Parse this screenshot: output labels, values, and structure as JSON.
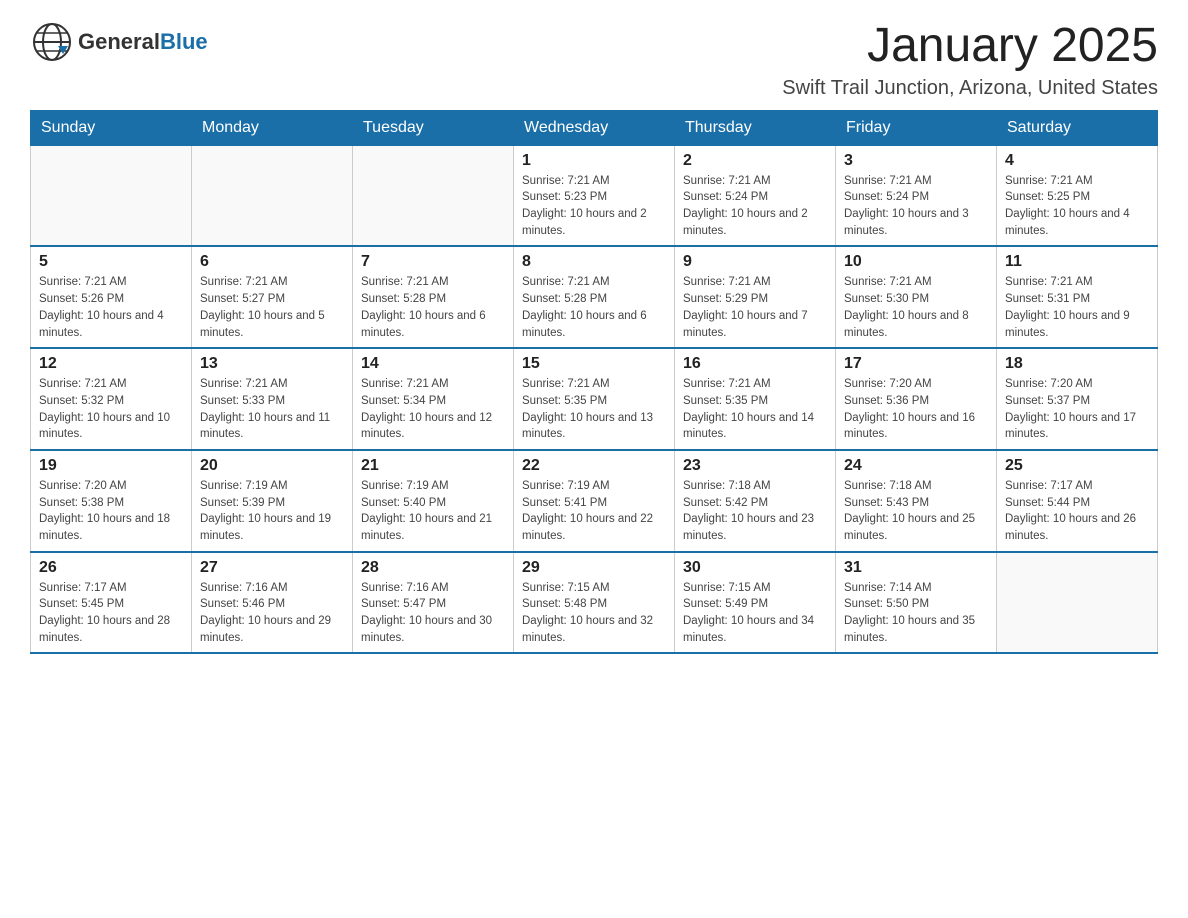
{
  "header": {
    "logo_general": "General",
    "logo_blue": "Blue",
    "month_year": "January 2025",
    "location": "Swift Trail Junction, Arizona, United States"
  },
  "weekdays": [
    "Sunday",
    "Monday",
    "Tuesday",
    "Wednesday",
    "Thursday",
    "Friday",
    "Saturday"
  ],
  "weeks": [
    [
      {
        "day": "",
        "sunrise": "",
        "sunset": "",
        "daylight": ""
      },
      {
        "day": "",
        "sunrise": "",
        "sunset": "",
        "daylight": ""
      },
      {
        "day": "",
        "sunrise": "",
        "sunset": "",
        "daylight": ""
      },
      {
        "day": "1",
        "sunrise": "Sunrise: 7:21 AM",
        "sunset": "Sunset: 5:23 PM",
        "daylight": "Daylight: 10 hours and 2 minutes."
      },
      {
        "day": "2",
        "sunrise": "Sunrise: 7:21 AM",
        "sunset": "Sunset: 5:24 PM",
        "daylight": "Daylight: 10 hours and 2 minutes."
      },
      {
        "day": "3",
        "sunrise": "Sunrise: 7:21 AM",
        "sunset": "Sunset: 5:24 PM",
        "daylight": "Daylight: 10 hours and 3 minutes."
      },
      {
        "day": "4",
        "sunrise": "Sunrise: 7:21 AM",
        "sunset": "Sunset: 5:25 PM",
        "daylight": "Daylight: 10 hours and 4 minutes."
      }
    ],
    [
      {
        "day": "5",
        "sunrise": "Sunrise: 7:21 AM",
        "sunset": "Sunset: 5:26 PM",
        "daylight": "Daylight: 10 hours and 4 minutes."
      },
      {
        "day": "6",
        "sunrise": "Sunrise: 7:21 AM",
        "sunset": "Sunset: 5:27 PM",
        "daylight": "Daylight: 10 hours and 5 minutes."
      },
      {
        "day": "7",
        "sunrise": "Sunrise: 7:21 AM",
        "sunset": "Sunset: 5:28 PM",
        "daylight": "Daylight: 10 hours and 6 minutes."
      },
      {
        "day": "8",
        "sunrise": "Sunrise: 7:21 AM",
        "sunset": "Sunset: 5:28 PM",
        "daylight": "Daylight: 10 hours and 6 minutes."
      },
      {
        "day": "9",
        "sunrise": "Sunrise: 7:21 AM",
        "sunset": "Sunset: 5:29 PM",
        "daylight": "Daylight: 10 hours and 7 minutes."
      },
      {
        "day": "10",
        "sunrise": "Sunrise: 7:21 AM",
        "sunset": "Sunset: 5:30 PM",
        "daylight": "Daylight: 10 hours and 8 minutes."
      },
      {
        "day": "11",
        "sunrise": "Sunrise: 7:21 AM",
        "sunset": "Sunset: 5:31 PM",
        "daylight": "Daylight: 10 hours and 9 minutes."
      }
    ],
    [
      {
        "day": "12",
        "sunrise": "Sunrise: 7:21 AM",
        "sunset": "Sunset: 5:32 PM",
        "daylight": "Daylight: 10 hours and 10 minutes."
      },
      {
        "day": "13",
        "sunrise": "Sunrise: 7:21 AM",
        "sunset": "Sunset: 5:33 PM",
        "daylight": "Daylight: 10 hours and 11 minutes."
      },
      {
        "day": "14",
        "sunrise": "Sunrise: 7:21 AM",
        "sunset": "Sunset: 5:34 PM",
        "daylight": "Daylight: 10 hours and 12 minutes."
      },
      {
        "day": "15",
        "sunrise": "Sunrise: 7:21 AM",
        "sunset": "Sunset: 5:35 PM",
        "daylight": "Daylight: 10 hours and 13 minutes."
      },
      {
        "day": "16",
        "sunrise": "Sunrise: 7:21 AM",
        "sunset": "Sunset: 5:35 PM",
        "daylight": "Daylight: 10 hours and 14 minutes."
      },
      {
        "day": "17",
        "sunrise": "Sunrise: 7:20 AM",
        "sunset": "Sunset: 5:36 PM",
        "daylight": "Daylight: 10 hours and 16 minutes."
      },
      {
        "day": "18",
        "sunrise": "Sunrise: 7:20 AM",
        "sunset": "Sunset: 5:37 PM",
        "daylight": "Daylight: 10 hours and 17 minutes."
      }
    ],
    [
      {
        "day": "19",
        "sunrise": "Sunrise: 7:20 AM",
        "sunset": "Sunset: 5:38 PM",
        "daylight": "Daylight: 10 hours and 18 minutes."
      },
      {
        "day": "20",
        "sunrise": "Sunrise: 7:19 AM",
        "sunset": "Sunset: 5:39 PM",
        "daylight": "Daylight: 10 hours and 19 minutes."
      },
      {
        "day": "21",
        "sunrise": "Sunrise: 7:19 AM",
        "sunset": "Sunset: 5:40 PM",
        "daylight": "Daylight: 10 hours and 21 minutes."
      },
      {
        "day": "22",
        "sunrise": "Sunrise: 7:19 AM",
        "sunset": "Sunset: 5:41 PM",
        "daylight": "Daylight: 10 hours and 22 minutes."
      },
      {
        "day": "23",
        "sunrise": "Sunrise: 7:18 AM",
        "sunset": "Sunset: 5:42 PM",
        "daylight": "Daylight: 10 hours and 23 minutes."
      },
      {
        "day": "24",
        "sunrise": "Sunrise: 7:18 AM",
        "sunset": "Sunset: 5:43 PM",
        "daylight": "Daylight: 10 hours and 25 minutes."
      },
      {
        "day": "25",
        "sunrise": "Sunrise: 7:17 AM",
        "sunset": "Sunset: 5:44 PM",
        "daylight": "Daylight: 10 hours and 26 minutes."
      }
    ],
    [
      {
        "day": "26",
        "sunrise": "Sunrise: 7:17 AM",
        "sunset": "Sunset: 5:45 PM",
        "daylight": "Daylight: 10 hours and 28 minutes."
      },
      {
        "day": "27",
        "sunrise": "Sunrise: 7:16 AM",
        "sunset": "Sunset: 5:46 PM",
        "daylight": "Daylight: 10 hours and 29 minutes."
      },
      {
        "day": "28",
        "sunrise": "Sunrise: 7:16 AM",
        "sunset": "Sunset: 5:47 PM",
        "daylight": "Daylight: 10 hours and 30 minutes."
      },
      {
        "day": "29",
        "sunrise": "Sunrise: 7:15 AM",
        "sunset": "Sunset: 5:48 PM",
        "daylight": "Daylight: 10 hours and 32 minutes."
      },
      {
        "day": "30",
        "sunrise": "Sunrise: 7:15 AM",
        "sunset": "Sunset: 5:49 PM",
        "daylight": "Daylight: 10 hours and 34 minutes."
      },
      {
        "day": "31",
        "sunrise": "Sunrise: 7:14 AM",
        "sunset": "Sunset: 5:50 PM",
        "daylight": "Daylight: 10 hours and 35 minutes."
      },
      {
        "day": "",
        "sunrise": "",
        "sunset": "",
        "daylight": ""
      }
    ]
  ]
}
